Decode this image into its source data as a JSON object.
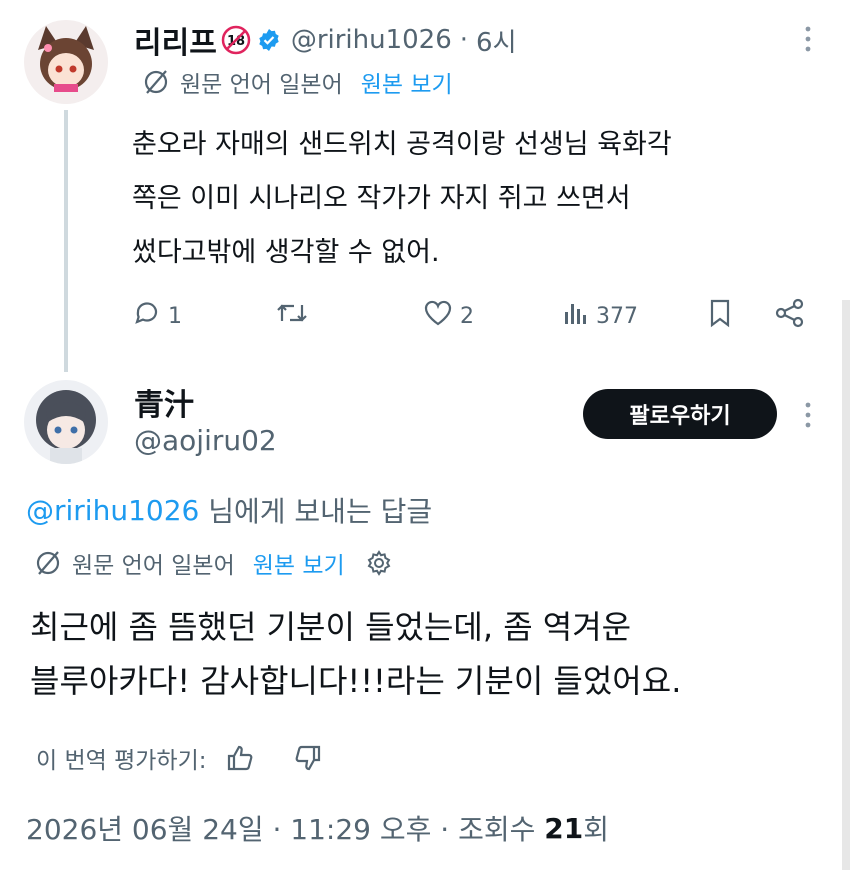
{
  "tweet1": {
    "display_name": "리리프",
    "age_badge": "18",
    "handle": "@ririhu1026",
    "separator": "·",
    "time": "6시",
    "translation_note": "원문 언어 일본어",
    "view_original": "원본 보기",
    "body_lines": [
      "춘오라 자매의 샌드위치 공격이랑 선생님 육화각",
      "쪽은 이미 시나리오 작가가 자지 쥐고 쓰면서",
      "썼다고밖에 생각할 수 없어."
    ],
    "actions": {
      "replies": "1",
      "retweets": "",
      "likes": "2",
      "views": "377"
    }
  },
  "tweet2": {
    "display_name": "青汁",
    "handle": "@aojiru02",
    "follow_label": "팔로우하기",
    "reply_to_handle": "@ririhu1026",
    "reply_to_suffix": " 님에게 보내는 답글",
    "translation_note": "원문 언어 일본어",
    "view_original": "원본 보기",
    "body_lines": [
      "최근에 좀 뜸했던 기분이 들었는데, 좀 역겨운",
      "블루아카다! 감사합니다!!!라는 기분이 들었어요."
    ],
    "rate_label": "이 번역 평가하기:",
    "timestamp": "2026년 06월 24일 · 11:29 오후 · 조회수 ",
    "view_count": "21",
    "view_unit": "회"
  },
  "colors": {
    "accent": "#1d9bf0",
    "text": "#0f1419",
    "muted": "#536471",
    "button": "#0f1419"
  },
  "icons": [
    "globe-slash-icon",
    "verified-badge-icon",
    "more-icon",
    "reply-icon",
    "retweet-icon",
    "like-icon",
    "views-icon",
    "bookmark-icon",
    "share-icon",
    "settings-icon",
    "thumbs-up-icon",
    "thumbs-down-icon"
  ]
}
